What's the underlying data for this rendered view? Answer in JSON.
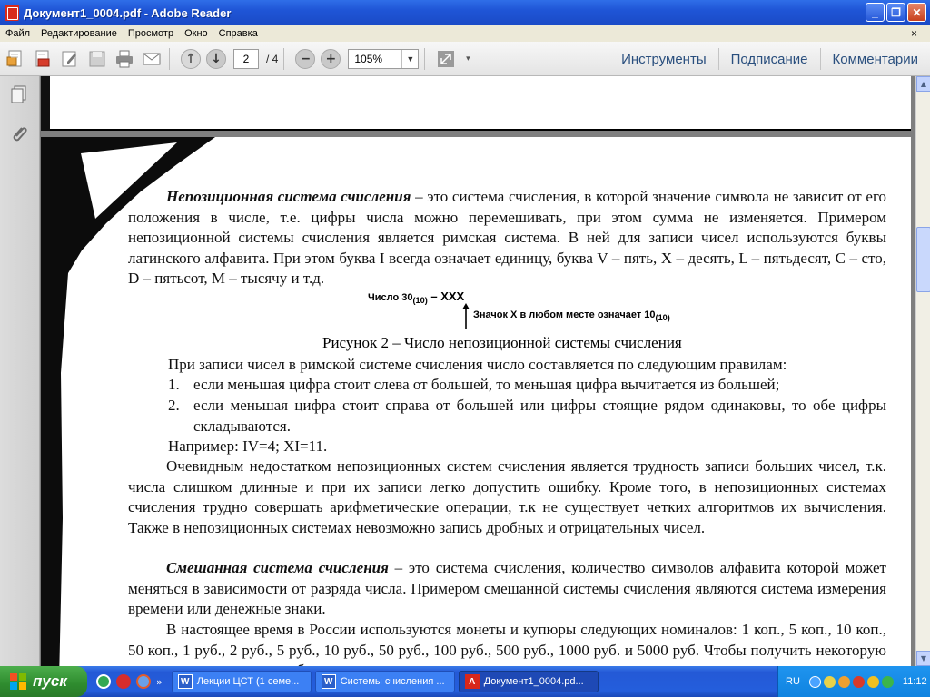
{
  "window": {
    "title": "Документ1_0004.pdf - Adobe Reader",
    "minimize": "_",
    "maximize": "❐",
    "close": "✕"
  },
  "menu": {
    "items": [
      "Файл",
      "Редактирование",
      "Просмотр",
      "Окно",
      "Справка"
    ],
    "close": "×"
  },
  "toolbar": {
    "current_page": "2",
    "total_pages": "/ 4",
    "zoom": "105%",
    "tools": "Инструменты",
    "sign": "Подписание",
    "comments": "Комментарии"
  },
  "document": {
    "p1_lead": "Непозиционная система счисления",
    "p1_rest": " – это система счисления, в которой значение символа не зависит от его положения в числе, т.е. цифры числа можно перемешивать, при этом сумма не изменяется. Примером непозиционной системы счисления является римская система. В ней для записи чисел используются буквы латинского алфавита. При этом буква I всегда означает единицу, буква V – пять, X – десять, L – пятьдесят, C – сто, D – пятьсот, M – тысячу и т.д.",
    "fig_number_label": "Число 30",
    "fig_number_sub": "(10)",
    "fig_number_value": " – XXX",
    "fig_note": "Значок X в любом месте означает 10",
    "fig_note_sub": "(10)",
    "caption": "Рисунок 2 – Число непозиционной системы счисления",
    "rules_intro": "При записи чисел в римской системе счисления число составляется по следующим правилам:",
    "rule1_num": "1.",
    "rule1": "если меньшая цифра стоит слева от большей, то меньшая цифра вычитается из большей;",
    "rule2_num": "2.",
    "rule2": "если меньшая цифра стоит справа от большей или цифры стоящие рядом одинаковы, то обе цифры складываются.",
    "example": "Например: IV=4; XI=11.",
    "p2": "Очевидным недостатком непозиционных систем счисления является трудность записи больших чисел, т.к. числа слишком длинные и при их записи легко допустить ошибку. Кроме того, в непозиционных системах счисления трудно совершать арифметические операции, т.к не существует четких алгоритмов их вычисления. Также в непозиционных системах невозможно запись дробных и отрицательных чисел.",
    "p3_lead": "Смешанная система счисления",
    "p3_rest": " – это система счисления, количество символов алфавита которой может меняться в зависимости от разряда числа. Примером смешанной системы счисления являются система измерения времени или денежные знаки.",
    "p4": "В настоящее время  в России используются монеты и купюры следующих номиналов: 1 коп., 5 коп., 10 коп., 50 коп., 1 руб., 2 руб., 5 руб., 10 руб., 50 руб., 100 руб., 500 руб., 1000 руб. и 5000 руб. Чтобы получить некоторую сумму в рублях, нам нужно использовать некоторое количество"
  },
  "taskbar": {
    "start": "пуск",
    "expand": "»",
    "tasks": [
      {
        "label": "Лекции ЦСТ (1 семе...",
        "icon": "W"
      },
      {
        "label": "Системы счисления ...",
        "icon": "W"
      },
      {
        "label": "Документ1_0004.pd...",
        "icon": "A"
      }
    ],
    "lang": "RU",
    "clock": "11:12"
  },
  "colors": {
    "titlebar": "#245edc",
    "toolbar_links": "#2a4f7e",
    "start_button": "#2e8b2e"
  }
}
